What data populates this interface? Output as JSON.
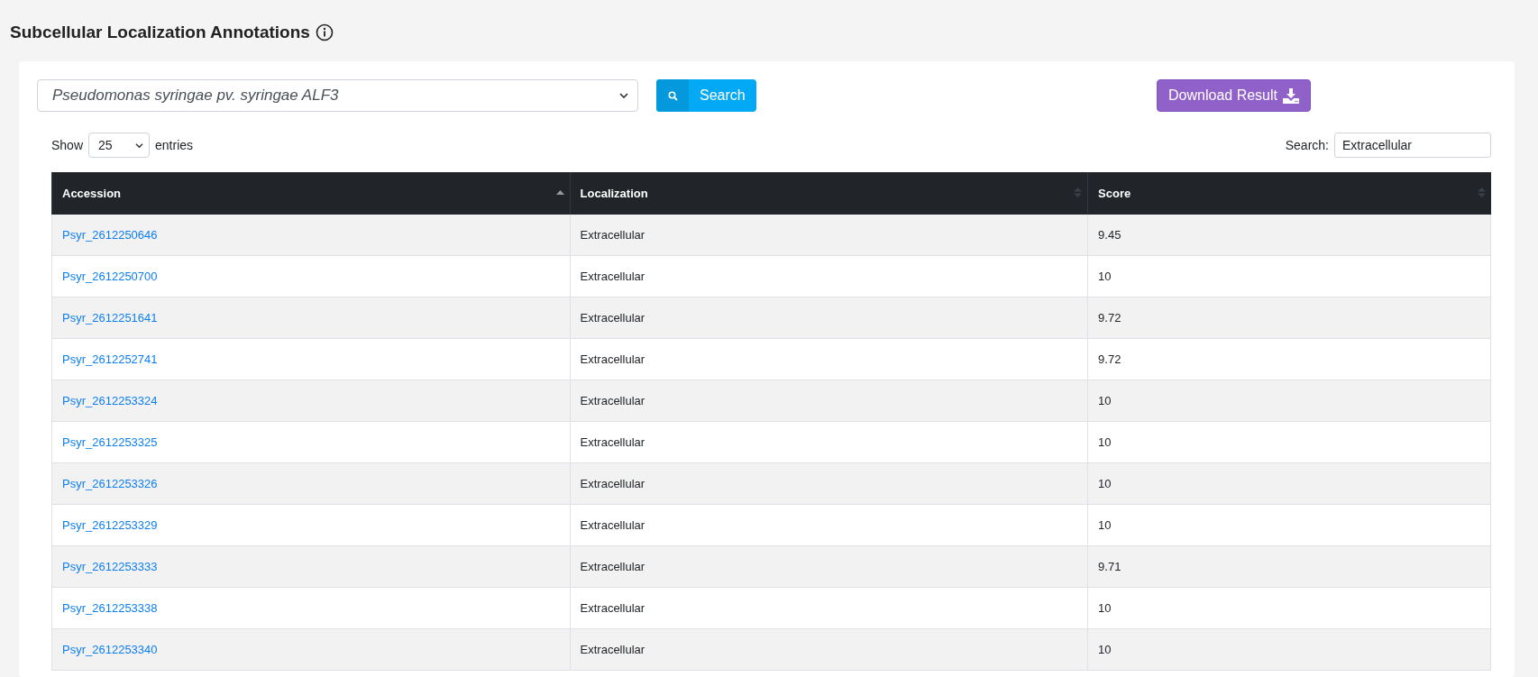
{
  "title": "Subcellular Localization Annotations",
  "organism_select": {
    "value": "Pseudomonas syringae pv. syringae ALF3"
  },
  "search_button": {
    "label": "Search"
  },
  "download_button": {
    "label": "Download Result"
  },
  "length_control": {
    "prefix": "Show",
    "value": "25",
    "suffix": "entries"
  },
  "filter": {
    "label": "Search:",
    "value": "Extracellular"
  },
  "table": {
    "columns": [
      {
        "label": "Accession",
        "sorted_ascending": true
      },
      {
        "label": "Localization",
        "sorted_ascending": false
      },
      {
        "label": "Score",
        "sorted_ascending": false
      }
    ],
    "rows": [
      [
        "Psyr_2612250646",
        "Extracellular",
        "9.45"
      ],
      [
        "Psyr_2612250700",
        "Extracellular",
        "10"
      ],
      [
        "Psyr_2612251641",
        "Extracellular",
        "9.72"
      ],
      [
        "Psyr_2612252741",
        "Extracellular",
        "9.72"
      ],
      [
        "Psyr_2612253324",
        "Extracellular",
        "10"
      ],
      [
        "Psyr_2612253325",
        "Extracellular",
        "10"
      ],
      [
        "Psyr_2612253326",
        "Extracellular",
        "10"
      ],
      [
        "Psyr_2612253329",
        "Extracellular",
        "10"
      ],
      [
        "Psyr_2612253333",
        "Extracellular",
        "9.71"
      ],
      [
        "Psyr_2612253338",
        "Extracellular",
        "10"
      ],
      [
        "Psyr_2612253340",
        "Extracellular",
        "10"
      ]
    ]
  }
}
